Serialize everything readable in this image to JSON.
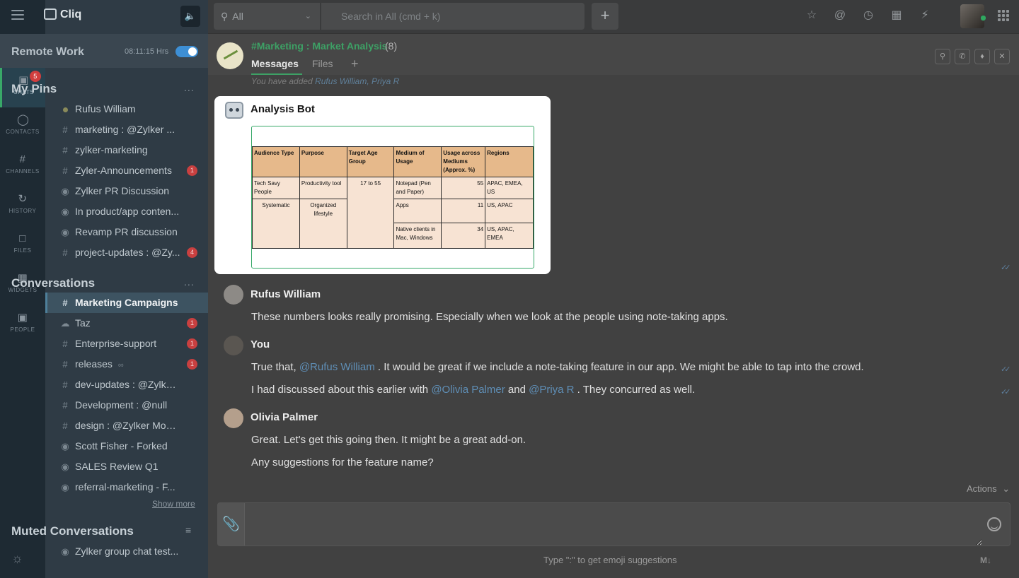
{
  "app": {
    "title": "Cliq"
  },
  "rail": {
    "items": [
      {
        "label": "CHATS",
        "icon": "chat-icon",
        "badge": "5",
        "active": true
      },
      {
        "label": "CONTACTS",
        "icon": "contacts-icon"
      },
      {
        "label": "CHANNELS",
        "icon": "hash-icon"
      },
      {
        "label": "HISTORY",
        "icon": "history-icon"
      },
      {
        "label": "FILES",
        "icon": "file-icon"
      },
      {
        "label": "WIDGETS",
        "icon": "widgets-icon"
      },
      {
        "label": "PEOPLE",
        "icon": "people-icon"
      }
    ]
  },
  "status": {
    "title": "Remote Work",
    "time": "08:11:15 Hrs",
    "toggle_on": true
  },
  "pins": {
    "heading": "My Pins",
    "more": "...",
    "items": [
      {
        "prefix": "dot",
        "label": "Rufus William"
      },
      {
        "prefix": "#",
        "label": "marketing : @Zylker ..."
      },
      {
        "prefix": "#",
        "label": "zylker-marketing"
      },
      {
        "prefix": "#",
        "label": "Zyler-Announcements",
        "badge": "1"
      },
      {
        "prefix": "group",
        "label": "Zylker PR Discussion"
      },
      {
        "prefix": "group",
        "label": "In product/app conten..."
      },
      {
        "prefix": "group",
        "label": "Revamp PR discussion"
      },
      {
        "prefix": "#",
        "label": "project-updates : @Zy...",
        "badge": "4"
      }
    ]
  },
  "conversations": {
    "heading": "Conversations",
    "more": "...",
    "show_more": "Show more",
    "items": [
      {
        "prefix": "#",
        "label": "Marketing Campaigns",
        "active": true
      },
      {
        "prefix": "bot",
        "label": "Taz",
        "badge": "1"
      },
      {
        "prefix": "#",
        "label": "Enterprise-support",
        "badge": "1"
      },
      {
        "prefix": "#",
        "label": "releases",
        "suffix": "link-icon",
        "badge": "1"
      },
      {
        "prefix": "#",
        "label": "dev-updates : @Zylker..."
      },
      {
        "prefix": "#",
        "label": "Development : @null"
      },
      {
        "prefix": "#",
        "label": "design : @Zylker Mobi..."
      },
      {
        "prefix": "group",
        "label": "Scott Fisher - Forked"
      },
      {
        "prefix": "group",
        "label": "SALES Review Q1"
      },
      {
        "prefix": "group",
        "label": "referral-marketing - F..."
      }
    ]
  },
  "muted": {
    "heading": "Muted Conversations",
    "items": [
      {
        "prefix": "group",
        "label": "Zylker group chat test..."
      }
    ]
  },
  "search": {
    "scope": "All",
    "placeholder": "Search in All (cmd + k)"
  },
  "channel": {
    "name": "#Marketing : Market Analysis",
    "count": "(8)",
    "tabs": [
      "Messages",
      "Files"
    ]
  },
  "system_note": {
    "text": "You have added",
    "names": "Rufus William, Priya R"
  },
  "bot_message": {
    "author": "Analysis Bot",
    "table": {
      "headers": [
        "Audience Type",
        "Purpose",
        "Target Age Group",
        "Medium of Usage",
        "Usage across Mediums (Approx. %)",
        "Regions"
      ],
      "audience_1": "Tech Savy People",
      "purpose_1": "Productivity tool",
      "audience_2": "Systematic",
      "purpose_2": "Organized lifestyle",
      "age_group": "17 to 55",
      "rows": [
        {
          "medium": "Notepad (Pen and Paper)",
          "usage": "55",
          "regions": "APAC, EMEA, US"
        },
        {
          "medium": "Apps",
          "usage": "11",
          "regions": "US, APAC"
        },
        {
          "medium": "Native clients in Mac, Windows",
          "usage": "34",
          "regions": "US, APAC, EMEA"
        }
      ]
    }
  },
  "messages": [
    {
      "author": "Rufus William",
      "lines": [
        "These numbers looks really promising. Especially when we look at the people using note-taking apps."
      ]
    },
    {
      "author": "You",
      "line1": {
        "pre": "True that, ",
        "mention": "@Rufus William",
        "post": " . It would be great if we include a note-taking feature in our app. We might be able to tap into the crowd."
      },
      "line2": {
        "pre": "I had discussed about this earlier with ",
        "mention1": "@Olivia Palmer",
        "mid": " and ",
        "mention2": "@Priya R",
        "post": " . They concurred as well."
      }
    },
    {
      "author": "Olivia Palmer",
      "lines": [
        "Great.  Let's get this going then. It might be a great add-on.",
        "Any suggestions for the feature name?"
      ]
    }
  ],
  "composer": {
    "actions": "Actions",
    "hint": "Type \":\" to get emoji suggestions",
    "md": "M↓"
  }
}
